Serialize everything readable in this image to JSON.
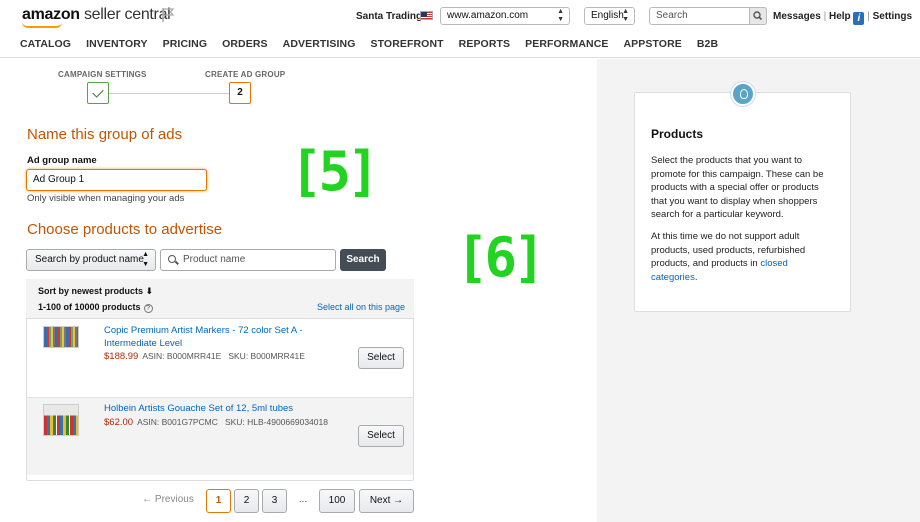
{
  "header": {
    "logo_brand": "amazon",
    "logo_product": "seller central",
    "store_name": "Santa Trading",
    "marketplace": "www.amazon.com",
    "language": "English",
    "search_placeholder": "Search",
    "links": {
      "messages": "Messages",
      "sep1": "|",
      "help": "Help",
      "info": "i",
      "settings": "Settings"
    }
  },
  "nav": [
    "CATALOG",
    "INVENTORY",
    "PRICING",
    "ORDERS",
    "ADVERTISING",
    "STOREFRONT",
    "REPORTS",
    "PERFORMANCE",
    "APPSTORE",
    "B2B"
  ],
  "steps": {
    "step1_label": "CAMPAIGN SETTINGS",
    "step2_label": "CREATE AD GROUP",
    "step2_number": "2"
  },
  "ad_group": {
    "heading": "Name this group of ads",
    "field_label": "Ad group name",
    "value": "Ad Group 1",
    "hint": "Only visible when managing your ads"
  },
  "annotations": {
    "label5": "[5]",
    "label6": "[6]"
  },
  "products_section": {
    "heading": "Choose products to advertise",
    "search_by": "Search by product name",
    "search_placeholder": "Product name",
    "search_button": "Search",
    "sort_label": "Sort by newest products",
    "sort_arrow": "⬇",
    "count": "1-100 of 10000 products",
    "help_icon": "?",
    "select_all": "Select all on this page",
    "items": [
      {
        "name": "Copic Premium Artist Markers - 72 color Set A - Intermediate Level",
        "price": "$188.99",
        "asin": "ASIN: B000MRR41E",
        "sku": "SKU: B000MRR41E",
        "button": "Select"
      },
      {
        "name": "Holbein Artists Gouache Set of 12, 5ml tubes",
        "price": "$62.00",
        "asin": "ASIN: B001G7PCMC",
        "sku": "SKU: HLB-4900669034018",
        "button": "Select"
      }
    ]
  },
  "pagination": {
    "previous": "← Previous",
    "pages": [
      "1",
      "2",
      "3"
    ],
    "ellipsis": "...",
    "last": "100",
    "next": "Next →"
  },
  "help_panel": {
    "title": "Products",
    "paragraph1": "Select the products that you want to promote for this campaign. These can be products with a special offer or products that you want to display when shoppers search for a particular keyword.",
    "paragraph2_text": "At this time we do not support adult products, used products, refurbished products, and products in",
    "paragraph2_link": "closed categories",
    "paragraph2_end": "."
  },
  "colors": {
    "accent_orange": "#c45500",
    "link_blue": "#0066c0",
    "annotation_green": "#22d322"
  }
}
